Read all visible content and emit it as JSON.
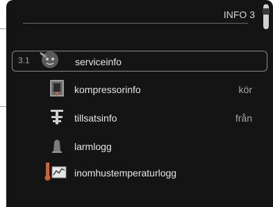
{
  "header": {
    "title": "INFO 3"
  },
  "menu": [
    {
      "index": "3.1",
      "label": "serviceinfo",
      "value": "",
      "icon": "service-icon"
    },
    {
      "index": "",
      "label": "kompressorinfo",
      "value": "kör",
      "icon": "compressor-icon"
    },
    {
      "index": "",
      "label": "tillsatsinfo",
      "value": "från",
      "icon": "heater-icon"
    },
    {
      "index": "",
      "label": "larmlogg",
      "value": "",
      "icon": "alarm-bell-icon"
    },
    {
      "index": "",
      "label": "inomhustemperaturlogg",
      "value": "",
      "icon": "temperature-log-icon"
    }
  ]
}
